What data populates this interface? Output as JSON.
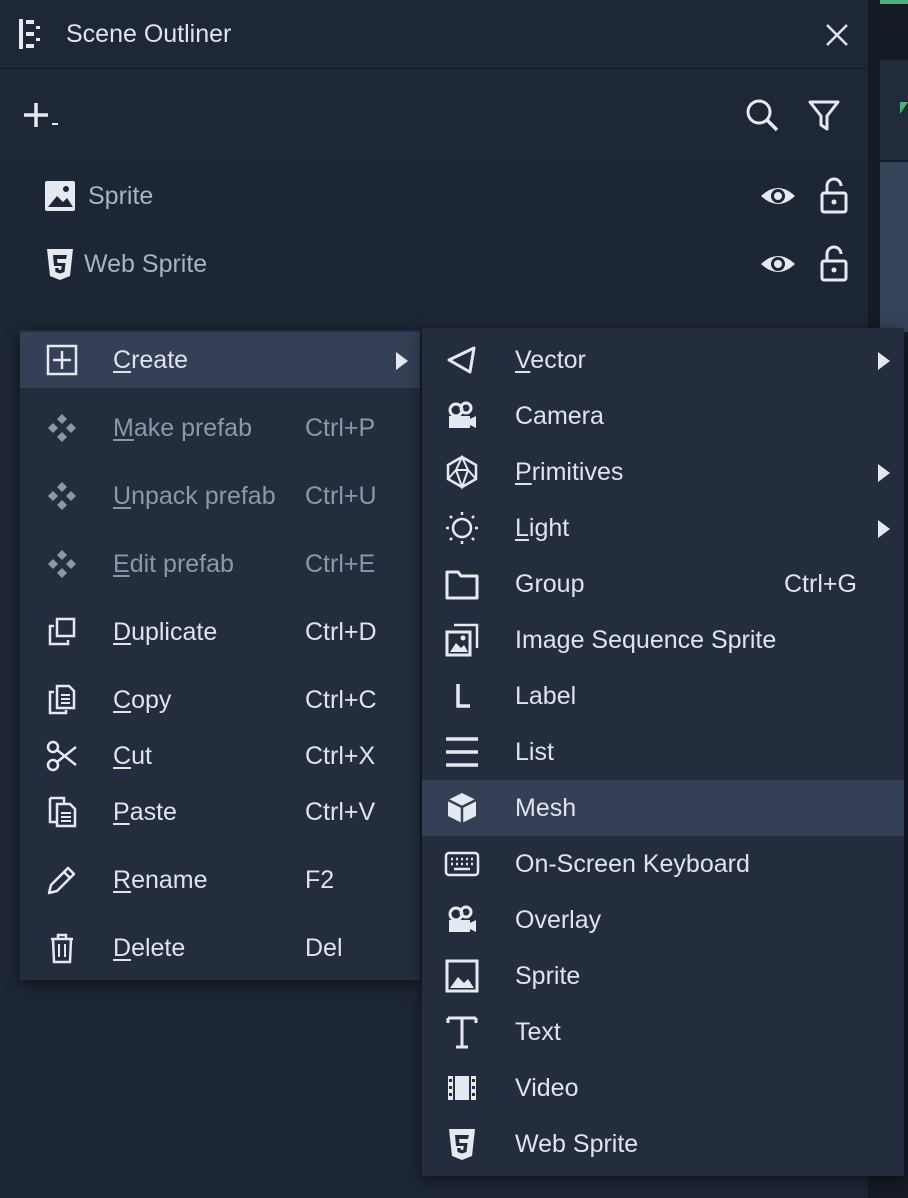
{
  "window": {
    "title": "Scene Outliner",
    "icon": "outliner-icon"
  },
  "toolbar": {
    "add_icon": "plus-dropdown-icon",
    "search_icon": "search-icon",
    "filter_icon": "filter-icon"
  },
  "tree": {
    "items": [
      {
        "label": "Sprite",
        "icon": "image-icon",
        "visible": true,
        "locked": false
      },
      {
        "label": "Web Sprite",
        "icon": "html5-icon",
        "visible": true,
        "locked": false
      }
    ]
  },
  "context_menu": {
    "items": [
      {
        "pre": "",
        "u": "C",
        "post": "reate",
        "shortcut": "",
        "submenu": true,
        "highlighted": true,
        "disabled": false,
        "icon": "plus-square-icon"
      },
      {
        "pre": "",
        "u": "M",
        "post": "ake prefab",
        "shortcut": "Ctrl+P",
        "disabled": true,
        "icon": "prefab-icon"
      },
      {
        "pre": "",
        "u": "U",
        "post": "npack prefab",
        "shortcut": "Ctrl+U",
        "disabled": true,
        "icon": "prefab-icon"
      },
      {
        "pre": "",
        "u": "E",
        "post": "dit prefab",
        "shortcut": "Ctrl+E",
        "disabled": true,
        "icon": "prefab-icon"
      },
      {
        "pre": "",
        "u": "D",
        "post": "uplicate",
        "shortcut": "Ctrl+D",
        "disabled": false,
        "icon": "duplicate-icon"
      },
      {
        "pre": "",
        "u": "C",
        "post": "opy",
        "shortcut": "Ctrl+C",
        "disabled": false,
        "icon": "copy-icon"
      },
      {
        "pre": "",
        "u": "C",
        "post": "ut",
        "shortcut": "Ctrl+X",
        "disabled": false,
        "icon": "scissors-icon"
      },
      {
        "pre": "",
        "u": "P",
        "post": "aste",
        "shortcut": "Ctrl+V",
        "disabled": false,
        "icon": "paste-icon"
      },
      {
        "pre": "",
        "u": "R",
        "post": "ename",
        "shortcut": "F2",
        "disabled": false,
        "icon": "pencil-icon"
      },
      {
        "pre": "",
        "u": "D",
        "post": "elete",
        "shortcut": "Del",
        "disabled": false,
        "icon": "trash-icon"
      }
    ]
  },
  "create_submenu": {
    "items": [
      {
        "pre": "",
        "u": "V",
        "post": "ector",
        "shortcut": "",
        "submenu": true,
        "icon": "vector-icon"
      },
      {
        "pre": "Camera",
        "u": "",
        "post": "",
        "shortcut": "",
        "icon": "camera-icon"
      },
      {
        "pre": "",
        "u": "P",
        "post": "rimitives",
        "shortcut": "",
        "submenu": true,
        "icon": "polyhedron-icon"
      },
      {
        "pre": "",
        "u": "L",
        "post": "ight",
        "shortcut": "",
        "submenu": true,
        "icon": "sun-icon"
      },
      {
        "pre": "Group",
        "u": "",
        "post": "",
        "shortcut": "Ctrl+G",
        "icon": "folder-icon"
      },
      {
        "pre": "Image Sequence Sprite",
        "u": "",
        "post": "",
        "shortcut": "",
        "icon": "image-sequence-icon"
      },
      {
        "pre": "Label",
        "u": "",
        "post": "",
        "shortcut": "",
        "icon": "label-icon"
      },
      {
        "pre": "List",
        "u": "",
        "post": "",
        "shortcut": "",
        "icon": "list-icon"
      },
      {
        "pre": "Mesh",
        "u": "",
        "post": "",
        "shortcut": "",
        "highlighted": true,
        "icon": "cube-icon"
      },
      {
        "pre": "On-Screen Keyboard",
        "u": "",
        "post": "",
        "shortcut": "",
        "icon": "keyboard-icon"
      },
      {
        "pre": "Overlay",
        "u": "",
        "post": "",
        "shortcut": "",
        "icon": "camera-icon"
      },
      {
        "pre": "Sprite",
        "u": "",
        "post": "",
        "shortcut": "",
        "icon": "image-icon"
      },
      {
        "pre": "Text",
        "u": "",
        "post": "",
        "shortcut": "",
        "icon": "text-icon"
      },
      {
        "pre": "Video",
        "u": "",
        "post": "",
        "shortcut": "",
        "icon": "film-icon"
      },
      {
        "pre": "Web Sprite",
        "u": "",
        "post": "",
        "shortcut": "",
        "icon": "html5-icon"
      }
    ]
  },
  "colors": {
    "accent": "#4fb07c",
    "menu_bg": "#232d3d",
    "highlight": "#353f55",
    "panel_bg": "#1e2735",
    "disabled_text": "#8c97a8"
  }
}
